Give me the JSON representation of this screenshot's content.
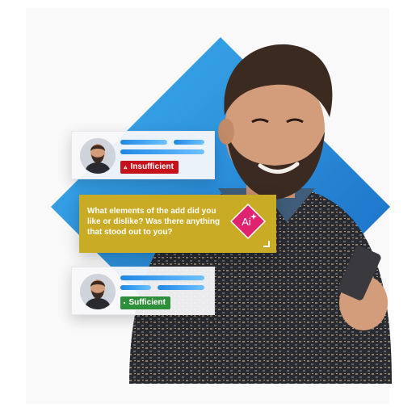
{
  "cards": [
    {
      "status_label": "Insufficient",
      "status_color": "#c4111b",
      "status_icon": "warning-icon"
    },
    {
      "status_label": "Sufficient",
      "status_color": "#2f8e3a",
      "status_icon": "check-circle-icon"
    }
  ],
  "ai_prompt": {
    "question": "What elements of the add did you like or dislike? Was there anything that stood out to you?",
    "badge_label": "Ai",
    "badge_color": "#e0236f"
  },
  "colors": {
    "diamond_start": "#1e88e5",
    "diamond_end": "#3fb2f0",
    "card_bg": "#c9ab25"
  }
}
